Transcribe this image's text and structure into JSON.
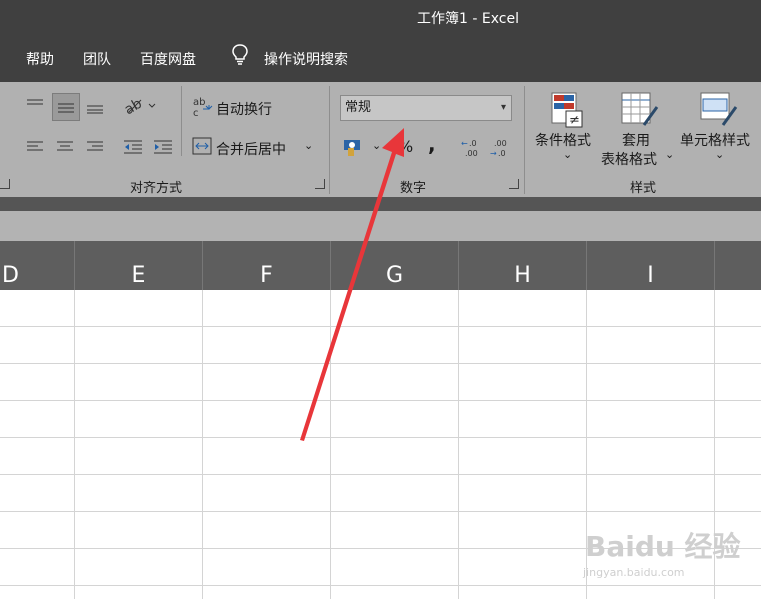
{
  "window": {
    "title": "工作簿1  -  Excel"
  },
  "menu": {
    "items": [
      "帮助",
      "团队",
      "百度网盘"
    ],
    "search_label": "操作说明搜索"
  },
  "ribbon": {
    "alignment": {
      "label": "对齐方式",
      "wrap_text": "自动换行",
      "merge_center": "合并后居中"
    },
    "number": {
      "label": "数字",
      "format_value": "常规",
      "percent": "%",
      "comma": ",",
      "inc_decimal_top": "←.0",
      "inc_decimal_bottom": ".00",
      "dec_decimal_top": ".00",
      "dec_decimal_bottom": "→.0"
    },
    "styles": {
      "label": "样式",
      "conditional": "条件格式",
      "table_line1": "套用",
      "table_line2": "表格格式",
      "cell_styles": "单元格样式"
    }
  },
  "columns": [
    "D",
    "E",
    "F",
    "G",
    "H",
    "I"
  ],
  "watermark": {
    "brand": "Baidu 经验",
    "url": "jingyan.baidu.com"
  },
  "annotation": {
    "arrow_color": "#e8363a"
  }
}
